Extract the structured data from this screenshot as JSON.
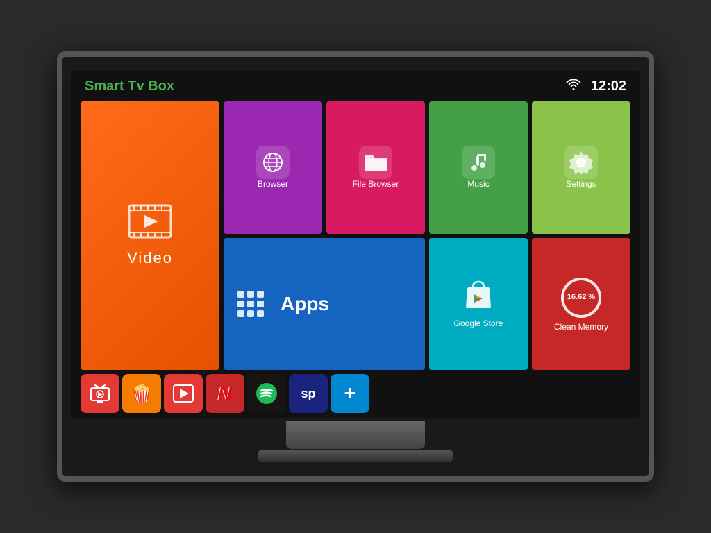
{
  "brand": {
    "name_white": "Smart",
    "name_green": "Tv Box"
  },
  "header": {
    "time": "12:02"
  },
  "tiles": {
    "video": {
      "label": "Video"
    },
    "browser": {
      "label": "Browser"
    },
    "file_browser": {
      "label": "File Browser"
    },
    "music": {
      "label": "Music"
    },
    "settings": {
      "label": "Settings"
    },
    "apps": {
      "label": "Apps"
    },
    "google_store": {
      "label": "Google Store"
    },
    "clean_memory": {
      "percent": "16.62 %",
      "label": "Clean Memory"
    }
  },
  "dock": {
    "items": [
      {
        "id": "tv-app",
        "emoji": "📺",
        "color": "#e53935"
      },
      {
        "id": "popcorn-app",
        "emoji": "🍿",
        "color": "#f57c00"
      },
      {
        "id": "video-app",
        "emoji": "▶",
        "color": "#e53935"
      },
      {
        "id": "netflix-app",
        "label": "N",
        "color": "#c62828"
      },
      {
        "id": "spotify-app",
        "label": "♫",
        "color": "#2d6a2d"
      },
      {
        "id": "sp-app",
        "label": "sp",
        "color": "#1a237e"
      },
      {
        "id": "add-app",
        "label": "+",
        "color": "#0288d1"
      }
    ]
  }
}
